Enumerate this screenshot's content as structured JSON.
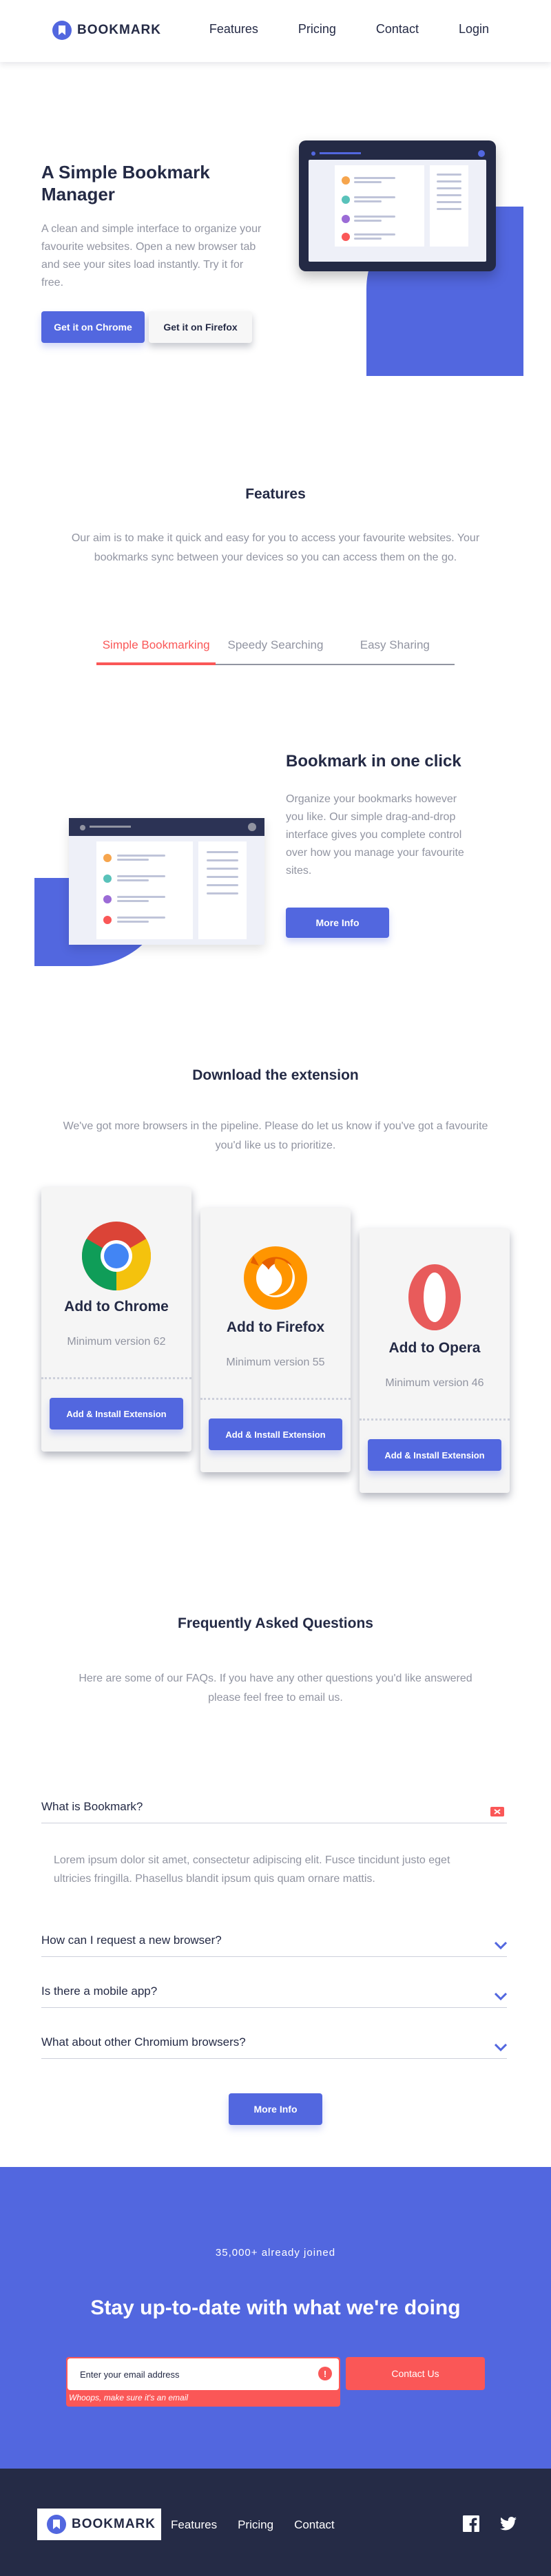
{
  "nav": {
    "logo": "BOOKMARK",
    "links": [
      "Features",
      "Pricing",
      "Contact",
      "Login"
    ]
  },
  "hero": {
    "title": "A Simple Bookmark Manager",
    "description": "A clean and simple interface to organize your favourite websites. Open a new browser tab and see your sites load instantly. Try it for free.",
    "chrome_button": "Get it on Chrome",
    "firefox_button": "Get it on Firefox"
  },
  "features": {
    "title": "Features",
    "description": "Our aim is to make it quick and easy for you to access your favourite websites. Your bookmarks sync between your devices so you can access them on the go.",
    "tabs": [
      "Simple Bookmarking",
      "Speedy Searching",
      "Easy Sharing"
    ],
    "active_tab": "Simple Bookmarking",
    "panel": {
      "title": "Bookmark in one click",
      "description": "Organize your bookmarks however you like. Our simple drag-and-drop interface gives you complete control over how you manage your favourite sites.",
      "button": "More Info"
    }
  },
  "extensions": {
    "title": "Download the extension",
    "description": "We've got more browsers in the pipeline. Please do let us know if you've got a favourite you'd like us to prioritize.",
    "cards": [
      {
        "title": "Add to Chrome",
        "version": "Minimum version 62",
        "button": "Add & Install Extension",
        "icon": "chrome-icon"
      },
      {
        "title": "Add to Firefox",
        "version": "Minimum version 55",
        "button": "Add & Install Extension",
        "icon": "firefox-icon"
      },
      {
        "title": "Add to Opera",
        "version": "Minimum version 46",
        "button": "Add & Install Extension",
        "icon": "opera-icon"
      }
    ]
  },
  "faq": {
    "title": "Frequently Asked Questions",
    "description": "Here are some of our FAQs. If you have any other questions you'd like answered please feel free to email us.",
    "items": [
      {
        "question": "What is Bookmark?",
        "answer": "Lorem ipsum dolor sit amet, consectetur adipiscing elit. Fusce tincidunt justo eget ultricies fringilla. Phasellus blandit ipsum quis quam ornare mattis.",
        "open": true
      },
      {
        "question": "How can I request a new browser?",
        "open": false
      },
      {
        "question": "Is there a mobile app?",
        "open": false
      },
      {
        "question": "What about other Chromium browsers?",
        "open": false
      }
    ],
    "button": "More Info"
  },
  "newsletter": {
    "count": "35,000+ already joined",
    "title": "Stay up-to-date with what we're doing",
    "placeholder": "Enter your email address",
    "error_icon": "!",
    "error": "Whoops, make sure it's an email",
    "button": "Contact Us"
  },
  "footer": {
    "logo": "BOOKMARK",
    "links": [
      "Features",
      "Pricing",
      "Contact"
    ],
    "social": [
      "facebook-icon",
      "twitter-icon"
    ]
  },
  "colors": {
    "primary_blue": "#5267DF",
    "soft_red": "#FA5757",
    "dark_blue": "#242A45",
    "grayish_blue": "#9194A1"
  }
}
